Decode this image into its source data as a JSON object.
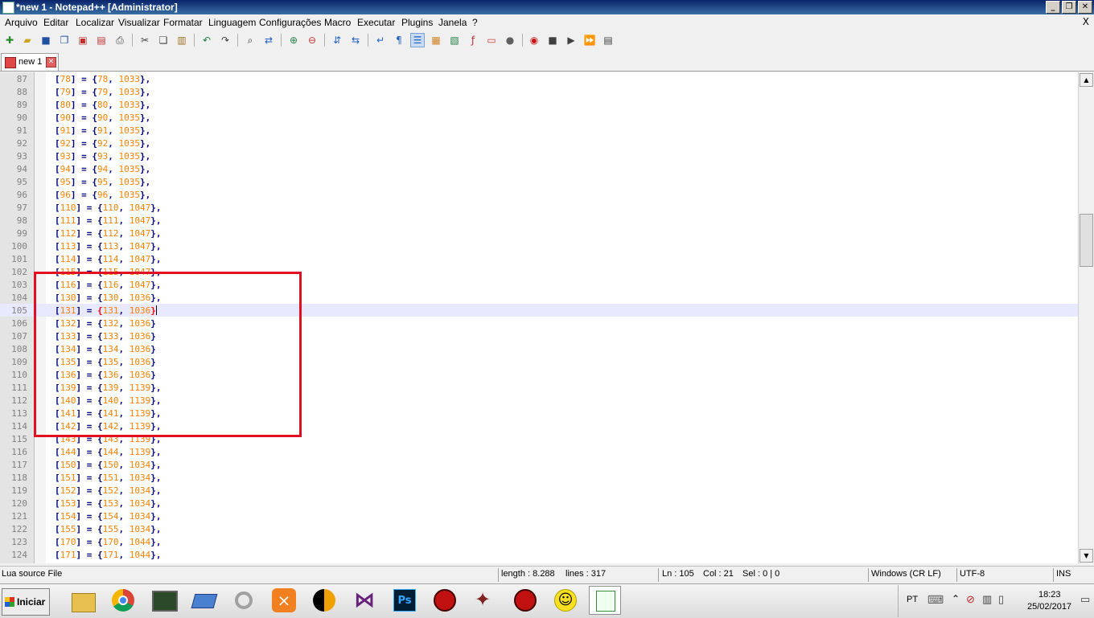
{
  "window": {
    "title": "*new 1 - Notepad++ [Administrator]"
  },
  "menu": [
    "Arquivo",
    "Editar",
    "Localizar",
    "Visualizar",
    "Formatar",
    "Linguagem",
    "Configurações",
    "Macro",
    "Executar",
    "Plugins",
    "Janela",
    "?"
  ],
  "menu_close": "X",
  "tab": {
    "label": "new 1"
  },
  "lines": [
    {
      "n": "87",
      "k": "78",
      "v": "78",
      "c": "1033",
      "end": "},"
    },
    {
      "n": "88",
      "k": "79",
      "v": "79",
      "c": "1033",
      "end": "},"
    },
    {
      "n": "89",
      "k": "80",
      "v": "80",
      "c": "1033",
      "end": "},"
    },
    {
      "n": "90",
      "k": "90",
      "v": "90",
      "c": "1035",
      "end": "},"
    },
    {
      "n": "91",
      "k": "91",
      "v": "91",
      "c": "1035",
      "end": "},"
    },
    {
      "n": "92",
      "k": "92",
      "v": "92",
      "c": "1035",
      "end": "},"
    },
    {
      "n": "93",
      "k": "93",
      "v": "93",
      "c": "1035",
      "end": "},"
    },
    {
      "n": "94",
      "k": "94",
      "v": "94",
      "c": "1035",
      "end": "},"
    },
    {
      "n": "95",
      "k": "95",
      "v": "95",
      "c": "1035",
      "end": "},"
    },
    {
      "n": "96",
      "k": "96",
      "v": "96",
      "c": "1035",
      "end": "},"
    },
    {
      "n": "97",
      "k": "110",
      "v": "110",
      "c": "1047",
      "end": "},"
    },
    {
      "n": "98",
      "k": "111",
      "v": "111",
      "c": "1047",
      "end": "},"
    },
    {
      "n": "99",
      "k": "112",
      "v": "112",
      "c": "1047",
      "end": "},"
    },
    {
      "n": "100",
      "k": "113",
      "v": "113",
      "c": "1047",
      "end": "},"
    },
    {
      "n": "101",
      "k": "114",
      "v": "114",
      "c": "1047",
      "end": "},"
    },
    {
      "n": "102",
      "k": "115",
      "v": "115",
      "c": "1047",
      "end": "},"
    },
    {
      "n": "103",
      "k": "116",
      "v": "116",
      "c": "1047",
      "end": "},"
    },
    {
      "n": "104",
      "k": "130",
      "v": "130",
      "c": "1036",
      "end": "},"
    },
    {
      "n": "105",
      "k": "131",
      "v": "131",
      "c": "1036",
      "end": "}"
    },
    {
      "n": "106",
      "k": "132",
      "v": "132",
      "c": "1036",
      "end": "}"
    },
    {
      "n": "107",
      "k": "133",
      "v": "133",
      "c": "1036",
      "end": "}"
    },
    {
      "n": "108",
      "k": "134",
      "v": "134",
      "c": "1036",
      "end": "}"
    },
    {
      "n": "109",
      "k": "135",
      "v": "135",
      "c": "1036",
      "end": "}"
    },
    {
      "n": "110",
      "k": "136",
      "v": "136",
      "c": "1036",
      "end": "}"
    },
    {
      "n": "111",
      "k": "139",
      "v": "139",
      "c": "1139",
      "end": "},"
    },
    {
      "n": "112",
      "k": "140",
      "v": "140",
      "c": "1139",
      "end": "},"
    },
    {
      "n": "113",
      "k": "141",
      "v": "141",
      "c": "1139",
      "end": "},"
    },
    {
      "n": "114",
      "k": "142",
      "v": "142",
      "c": "1139",
      "end": "},"
    },
    {
      "n": "115",
      "k": "143",
      "v": "143",
      "c": "1139",
      "end": "},"
    },
    {
      "n": "116",
      "k": "144",
      "v": "144",
      "c": "1139",
      "end": "},"
    },
    {
      "n": "117",
      "k": "150",
      "v": "150",
      "c": "1034",
      "end": "},"
    },
    {
      "n": "118",
      "k": "151",
      "v": "151",
      "c": "1034",
      "end": "},"
    },
    {
      "n": "119",
      "k": "152",
      "v": "152",
      "c": "1034",
      "end": "},"
    },
    {
      "n": "120",
      "k": "153",
      "v": "153",
      "c": "1034",
      "end": "},"
    },
    {
      "n": "121",
      "k": "154",
      "v": "154",
      "c": "1034",
      "end": "},"
    },
    {
      "n": "122",
      "k": "155",
      "v": "155",
      "c": "1034",
      "end": "},"
    },
    {
      "n": "123",
      "k": "170",
      "v": "170",
      "c": "1044",
      "end": "},"
    },
    {
      "n": "124",
      "k": "171",
      "v": "171",
      "c": "1044",
      "end": "},"
    }
  ],
  "current_line": "105",
  "status": {
    "filetype": "Lua source File",
    "length": "length : 8.288",
    "lines": "lines : 317",
    "ln": "Ln : 105",
    "col": "Col : 21",
    "sel": "Sel : 0 | 0",
    "eol": "Windows (CR LF)",
    "encoding": "UTF-8",
    "mode": "INS"
  },
  "taskbar": {
    "start": "Iniciar",
    "lang": "PT",
    "time": "18:23",
    "date": "25/02/2017"
  },
  "colors": {
    "highlight_box": "#e01020",
    "current_line_bg": "#e8e8ff",
    "number": "#ff8000",
    "operator": "#000080"
  }
}
